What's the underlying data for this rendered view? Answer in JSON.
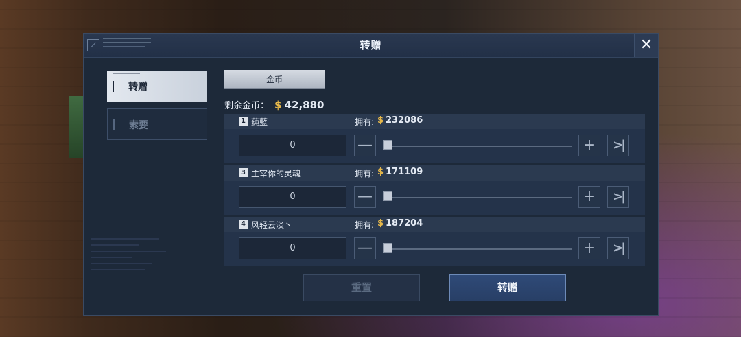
{
  "dialog": {
    "title": "转赠",
    "close_icon": "close-icon"
  },
  "tabs": [
    {
      "label": "转赠",
      "active": true
    },
    {
      "label": "索要",
      "active": false
    }
  ],
  "currency_tab": "金币",
  "balance": {
    "label": "剩余金币：",
    "symbol": "$",
    "amount": "42,880"
  },
  "players": [
    {
      "index": "1",
      "name": "莼藍",
      "owned_label": "拥有:",
      "symbol": "$",
      "owned": "232086",
      "qty": "0"
    },
    {
      "index": "3",
      "name": "主宰你的灵魂",
      "owned_label": "拥有:",
      "symbol": "$",
      "owned": "171109",
      "qty": "0"
    },
    {
      "index": "4",
      "name": "风轻云淡丶",
      "owned_label": "拥有:",
      "symbol": "$",
      "owned": "187204",
      "qty": "0"
    }
  ],
  "buttons": {
    "reset": "重置",
    "confirm": "转赠"
  },
  "colors": {
    "accent_gold": "#e6b84a",
    "panel": "#1d2939",
    "confirm": "#2f4a78"
  }
}
